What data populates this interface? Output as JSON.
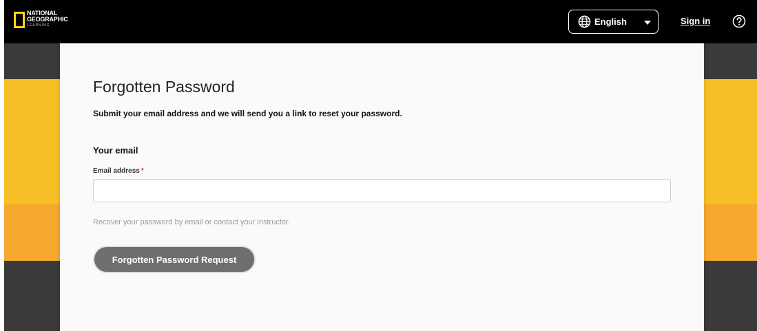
{
  "brand": {
    "logo_lines": [
      "NATIONAL",
      "GEOGRAPHIC"
    ],
    "logo_sub": "LEARNING",
    "logo_color": "#f9d71c"
  },
  "header": {
    "language_selected": "English",
    "sign_in_label": "Sign in",
    "help_icon": "question-circle-icon",
    "globe_icon": "globe-icon"
  },
  "form": {
    "title": "Forgotten Password",
    "subtitle": "Submit your email address and we will send you a link to reset your password.",
    "section_heading": "Your email",
    "email_label": "Email address",
    "required_marker": "*",
    "email_value": "",
    "help_text": "Recover your password by email or contact your instructor.",
    "submit_label": "Forgotten Password Request"
  },
  "colors": {
    "header_bg": "#000000",
    "band_dark": "#3a3a3a",
    "band_yellow": "#f6bf26",
    "band_orange": "#f7a82e",
    "button_bg": "#6f6f6f",
    "required": "#d33a3a"
  }
}
